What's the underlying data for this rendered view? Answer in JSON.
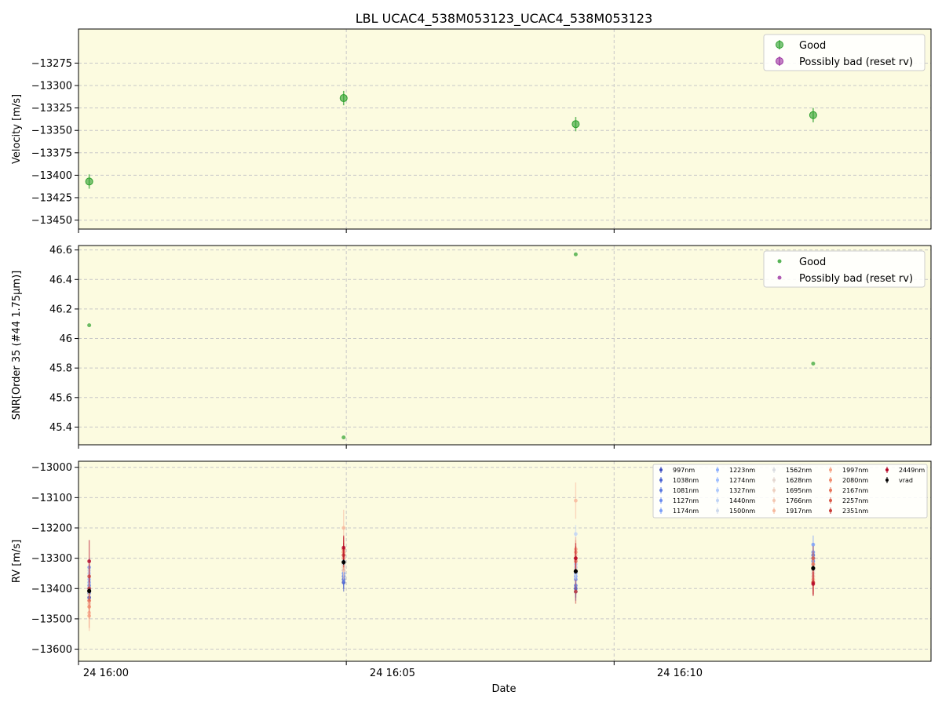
{
  "figure": {
    "title": "LBL UCAC4_538M053123_UCAC4_538M053123",
    "xlabel": "Date",
    "x_tick_labels": [
      "24 16:00",
      "24 16:05",
      "24 16:10"
    ]
  },
  "colors": {
    "plot_background": "#fcfbe0",
    "good": "#2ca02c",
    "bad": "#9b30a0",
    "vrad": "#000000",
    "grid": "#c8c8c8"
  },
  "chart_data": [
    {
      "type": "scatter",
      "panel": "velocity",
      "title": "LBL UCAC4_538M053123_UCAC4_538M053123",
      "xlabel": "",
      "ylabel": "Velocity [m/s]",
      "x_is_time": true,
      "xlim": [
        "16:00:00",
        "16:15:55"
      ],
      "ylim": [
        -13460,
        -13237
      ],
      "yticks": [
        -13450,
        -13425,
        -13400,
        -13375,
        -13350,
        -13325,
        -13300,
        -13275
      ],
      "grid": true,
      "legend_position": "top-right",
      "legend": [
        "Good",
        "Possibly bad (reset rv)"
      ],
      "series": [
        {
          "name": "Good",
          "x": [
            "16:00:12",
            "16:04:57",
            "16:09:17",
            "16:13:43"
          ],
          "y": [
            -13407,
            -13314,
            -13343,
            -13333
          ],
          "yerr": [
            8,
            8,
            8,
            8
          ]
        },
        {
          "name": "Possibly bad (reset rv)",
          "x": [],
          "y": [],
          "yerr": []
        }
      ]
    },
    {
      "type": "scatter",
      "panel": "snr",
      "xlabel": "",
      "ylabel": "SNR[Order 35 (#44 1.75μm)]",
      "x_is_time": true,
      "xlim": [
        "16:00:00",
        "16:15:55"
      ],
      "ylim": [
        45.28,
        46.63
      ],
      "yticks": [
        45.4,
        45.6,
        45.8,
        46.0,
        46.2,
        46.4,
        46.6
      ],
      "grid": true,
      "legend_position": "top-right",
      "legend": [
        "Good",
        "Possibly bad (reset rv)"
      ],
      "series": [
        {
          "name": "Good",
          "x": [
            "16:00:12",
            "16:04:57",
            "16:09:17",
            "16:13:43"
          ],
          "y": [
            46.09,
            45.33,
            46.57,
            45.83
          ]
        },
        {
          "name": "Possibly bad (reset rv)",
          "x": [],
          "y": []
        }
      ]
    },
    {
      "type": "scatter",
      "panel": "rv",
      "xlabel": "Date",
      "ylabel": "RV [m/s]",
      "x_is_time": true,
      "xlim": [
        "16:00:00",
        "16:15:55"
      ],
      "ylim": [
        -13640,
        -12980
      ],
      "yticks": [
        -13600,
        -13500,
        -13400,
        -13300,
        -13200,
        -13100,
        -13000
      ],
      "grid": true,
      "legend_position": "top-right",
      "x": [
        "16:00:12",
        "16:04:57",
        "16:09:17",
        "16:13:43"
      ],
      "series": [
        {
          "name": "997nm",
          "color": "#3b4cc0",
          "y": [
            -13430,
            -13380,
            -13400,
            -13300
          ],
          "yerr": [
            30,
            30,
            30,
            30
          ]
        },
        {
          "name": "1038nm",
          "color": "#4a63d3",
          "y": [
            -13415,
            -13370,
            -13410,
            -13290
          ],
          "yerr": [
            30,
            30,
            30,
            30
          ]
        },
        {
          "name": "1081nm",
          "color": "#5a78e0",
          "y": [
            -13400,
            -13360,
            -13390,
            -13310
          ],
          "yerr": [
            30,
            30,
            30,
            30
          ]
        },
        {
          "name": "1127nm",
          "color": "#6a8bef",
          "y": [
            -13390,
            -13350,
            -13370,
            -13280
          ],
          "yerr": [
            30,
            30,
            30,
            30
          ]
        },
        {
          "name": "1174nm",
          "color": "#7b9ff9",
          "y": [
            -13330,
            -13340,
            -13360,
            -13255
          ],
          "yerr": [
            30,
            30,
            30,
            30
          ]
        },
        {
          "name": "1223nm",
          "color": "#8db0fe",
          "y": [
            -13380,
            -13320,
            -13350,
            -13300
          ],
          "yerr": [
            30,
            30,
            30,
            30
          ]
        },
        {
          "name": "1274nm",
          "color": "#9ebeff",
          "y": [
            -13370,
            -13310,
            -13330,
            -13320
          ],
          "yerr": [
            30,
            30,
            30,
            30
          ]
        },
        {
          "name": "1327nm",
          "color": "#aec9fc",
          "y": [
            -13360,
            -13300,
            -13320,
            -13340
          ],
          "yerr": [
            30,
            30,
            30,
            30
          ]
        },
        {
          "name": "1440nm",
          "color": "#bfd3f6",
          "y": [
            -13350,
            -13290,
            -13220,
            -13350
          ],
          "yerr": [
            30,
            30,
            30,
            30
          ]
        },
        {
          "name": "1500nm",
          "color": "#cdd9ec",
          "y": [
            -13340,
            -13300,
            -13310,
            -13360
          ],
          "yerr": [
            30,
            30,
            30,
            30
          ]
        },
        {
          "name": "1562nm",
          "color": "#dadce0",
          "y": [
            -13420,
            -13310,
            -13330,
            -13320
          ],
          "yerr": [
            30,
            30,
            30,
            30
          ]
        },
        {
          "name": "1628nm",
          "color": "#e5d8d1",
          "y": [
            -13410,
            -13320,
            -13340,
            -13330
          ],
          "yerr": [
            30,
            30,
            30,
            30
          ]
        },
        {
          "name": "1695nm",
          "color": "#eed0c0",
          "y": [
            -13440,
            -13330,
            -13300,
            -13340
          ],
          "yerr": [
            30,
            30,
            30,
            30
          ]
        },
        {
          "name": "1766nm",
          "color": "#f3c7b1",
          "y": [
            -13450,
            -13340,
            -13290,
            -13350
          ],
          "yerr": [
            30,
            30,
            30,
            30
          ]
        },
        {
          "name": "1917nm",
          "color": "#f7b89c",
          "y": [
            -13480,
            -13200,
            -13110,
            -13360
          ],
          "yerr": [
            60,
            60,
            60,
            60
          ]
        },
        {
          "name": "1997nm",
          "color": "#f6a385",
          "y": [
            -13490,
            -13290,
            -13270,
            -13370
          ],
          "yerr": [
            40,
            40,
            40,
            40
          ]
        },
        {
          "name": "2080nm",
          "color": "#f08b6e",
          "y": [
            -13460,
            -13300,
            -13280,
            -13380
          ],
          "yerr": [
            40,
            40,
            40,
            40
          ]
        },
        {
          "name": "2167nm",
          "color": "#e7745b",
          "y": [
            -13440,
            -13280,
            -13310,
            -13320
          ],
          "yerr": [
            40,
            40,
            40,
            40
          ]
        },
        {
          "name": "2257nm",
          "color": "#da5a49",
          "y": [
            -13360,
            -13270,
            -13300,
            -13300
          ],
          "yerr": [
            40,
            40,
            40,
            40
          ]
        },
        {
          "name": "2351nm",
          "color": "#c83c38",
          "y": [
            -13400,
            -13290,
            -13410,
            -13380
          ],
          "yerr": [
            40,
            40,
            40,
            40
          ]
        },
        {
          "name": "2449nm",
          "color": "#b40426",
          "y": [
            -13310,
            -13265,
            -13300,
            -13385
          ],
          "yerr": [
            70,
            40,
            50,
            40
          ]
        },
        {
          "name": "vrad",
          "color": "#000000",
          "y": [
            -13408,
            -13313,
            -13343,
            -13333
          ],
          "yerr": [
            8,
            8,
            8,
            8
          ]
        }
      ]
    }
  ]
}
